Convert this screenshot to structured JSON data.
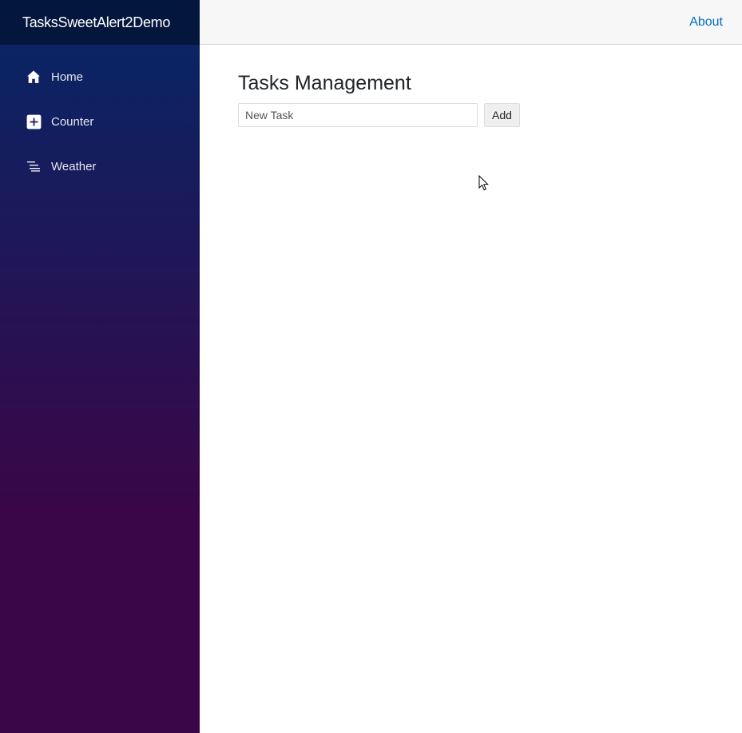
{
  "app": {
    "brand": "TasksSweetAlert2Demo"
  },
  "sidebar": {
    "items": [
      {
        "label": "Home",
        "icon": "home-icon"
      },
      {
        "label": "Counter",
        "icon": "plus-square-icon"
      },
      {
        "label": "Weather",
        "icon": "list-rich-icon"
      }
    ]
  },
  "header": {
    "about_label": "About"
  },
  "main": {
    "title": "Tasks Management",
    "task_input": {
      "value": "",
      "placeholder": "New Task"
    },
    "add_label": "Add"
  },
  "colors": {
    "sidebar_top": "#052767",
    "sidebar_bottom": "#3a0647",
    "link": "#0071c1",
    "topbar": "#f7f7f7"
  }
}
